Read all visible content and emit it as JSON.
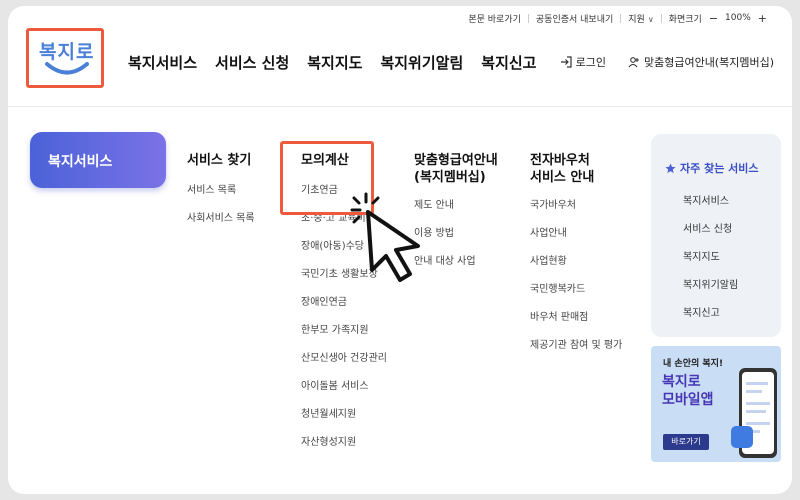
{
  "utility": {
    "skip": "본문 바로가기",
    "cert": "공동인증서 내보내기",
    "support": "지원",
    "support_chevron": "∨",
    "zoom_label": "화면크기",
    "zoom_minus": "−",
    "zoom_value": "100%",
    "zoom_plus": "+"
  },
  "logo": {
    "text": "복지로"
  },
  "gnb": [
    "복지서비스",
    "서비스 신청",
    "복지지도",
    "복지위기알림",
    "복지신고"
  ],
  "header_right": {
    "login": "로그인",
    "custom": "맞춤형급여안내(복지멤버십)"
  },
  "side": {
    "active": "복지서비스"
  },
  "columns": [
    {
      "title": "서비스 찾기",
      "items": [
        "서비스 목록",
        "사회서비스 목록"
      ]
    },
    {
      "title": "모의계산",
      "items": [
        "기초연금",
        "초·중·고 교육비",
        "장애(아동)수당",
        "국민기초 생활보장",
        "장애인연금",
        "한부모 가족지원",
        "산모신생아 건강관리",
        "아이돌봄 서비스",
        "청년월세지원",
        "자산형성지원"
      ]
    },
    {
      "title": "맞춤형급여안내\n(복지멤버십)",
      "items": [
        "제도 안내",
        "이용 방법",
        "안내 대상 사업"
      ]
    },
    {
      "title": "전자바우처\n서비스 안내",
      "items": [
        "국가바우처",
        "사업안내",
        "사업현황",
        "국민행복카드",
        "바우처 판매점",
        "제공기관 참여 및 평가"
      ]
    }
  ],
  "faq": {
    "title": "자주 찾는 서비스",
    "items": [
      "복지서비스",
      "서비스 신청",
      "복지지도",
      "복지위기알림",
      "복지신고"
    ]
  },
  "banner": {
    "small": "내 손안의 복지!",
    "big": "복지로\n모바일앱",
    "button": "바로가기"
  },
  "colors": {
    "accent": "#4b62d9",
    "highlight": "#f05a3c",
    "brand": "#4a80d8"
  }
}
